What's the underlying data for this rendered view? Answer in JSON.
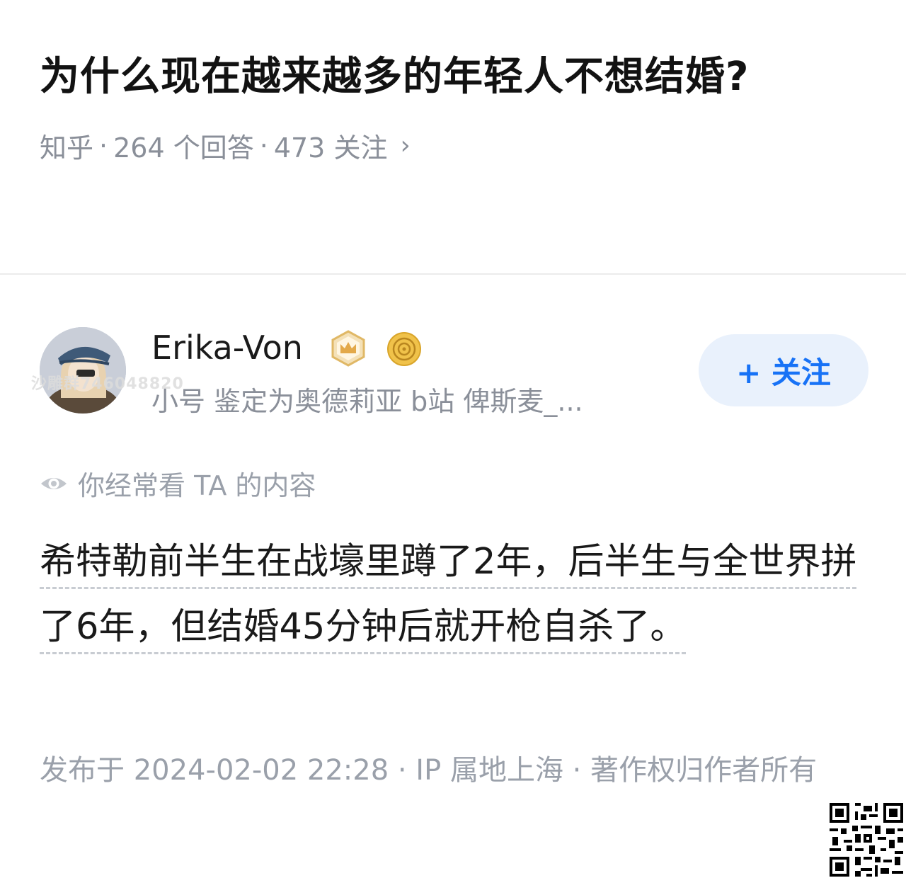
{
  "question": {
    "title": "为什么现在越来越多的年轻人不想结婚?",
    "source": "知乎",
    "answers": "264 个回答",
    "followers": "473 关注",
    "separator": "·",
    "chevron": "›"
  },
  "author": {
    "name": "Erika-Von",
    "bio": "小号 鉴定为奥德莉亚 b站 俾斯麦_...",
    "follow_label": "+ 关注",
    "badges": [
      "crown-badge-icon",
      "coin-badge-icon"
    ]
  },
  "watermark": "沙雕群746048820",
  "seen_note": "你经常看 TA 的内容",
  "answer": {
    "body": "希特勒前半生在战壕里蹲了2年，后半生与全世界拼了6年，但结婚45分钟后就开枪自杀了。"
  },
  "publish_info": "发布于 2024-02-02 22:28 · IP 属地上海 · 著作权归作者所有",
  "colors": {
    "accent": "#1772f6",
    "follow_bg": "#e9f1fc",
    "meta_gray": "#8a8f99",
    "badge_gold": "#e6b85c"
  }
}
